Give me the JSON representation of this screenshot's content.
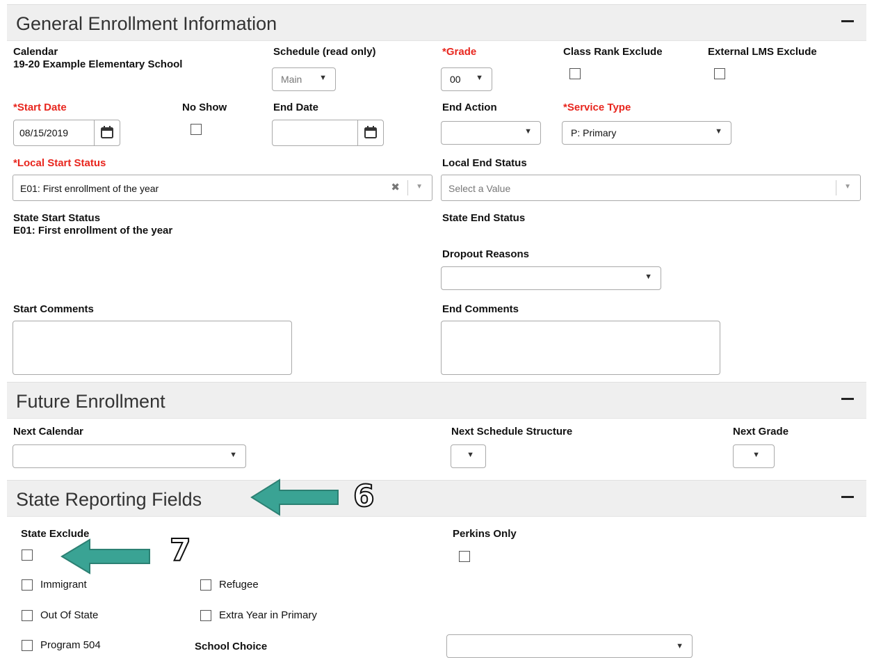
{
  "general": {
    "title": "General Enrollment Information",
    "calendar_label": "Calendar",
    "calendar_value": "19-20  Example Elementary School",
    "schedule_label": "Schedule (read only)",
    "schedule_value": "Main",
    "grade_req": "*",
    "grade_label": "Grade",
    "grade_value": "00",
    "class_rank_label": "Class Rank Exclude",
    "external_lms_label": "External LMS Exclude",
    "start_date_req": "*",
    "start_date_label": "Start Date",
    "start_date_value": "08/15/2019",
    "no_show_label": "No Show",
    "end_date_label": "End Date",
    "end_date_value": "",
    "end_action_label": "End Action",
    "end_action_value": "",
    "service_type_req": "*",
    "service_type_label": "Service Type",
    "service_type_value": "P: Primary",
    "local_start_req": "*",
    "local_start_label": "Local Start Status",
    "local_start_value": "E01: First enrollment of the year",
    "local_end_label": "Local End Status",
    "local_end_placeholder": "Select a Value",
    "state_start_label": "State Start Status",
    "state_start_value": "E01: First enrollment of the year",
    "state_end_label": "State End Status",
    "dropout_label": "Dropout Reasons",
    "start_comments_label": "Start Comments",
    "end_comments_label": "End Comments"
  },
  "future": {
    "title": "Future Enrollment",
    "next_calendar_label": "Next Calendar",
    "next_schedule_label": "Next Schedule Structure",
    "next_grade_label": "Next Grade"
  },
  "state": {
    "title": "State Reporting Fields",
    "state_exclude_label": "State Exclude",
    "perkins_label": "Perkins Only",
    "immigrant_label": "Immigrant",
    "refugee_label": "Refugee",
    "out_of_state_label": "Out Of State",
    "extra_year_label": "Extra Year in Primary",
    "program504_label": "Program 504",
    "school_choice_label": "School Choice"
  },
  "annotations": {
    "callout_6": "6",
    "callout_7": "7"
  },
  "colors": {
    "required": "#e8261e",
    "arrow": "#3aa394",
    "header_bg": "#efefef"
  },
  "icons": {
    "collapse": "minus-icon",
    "calendar": "calendar-icon",
    "dropdown": "chevron-down-icon",
    "clear": "clear-x-icon"
  }
}
